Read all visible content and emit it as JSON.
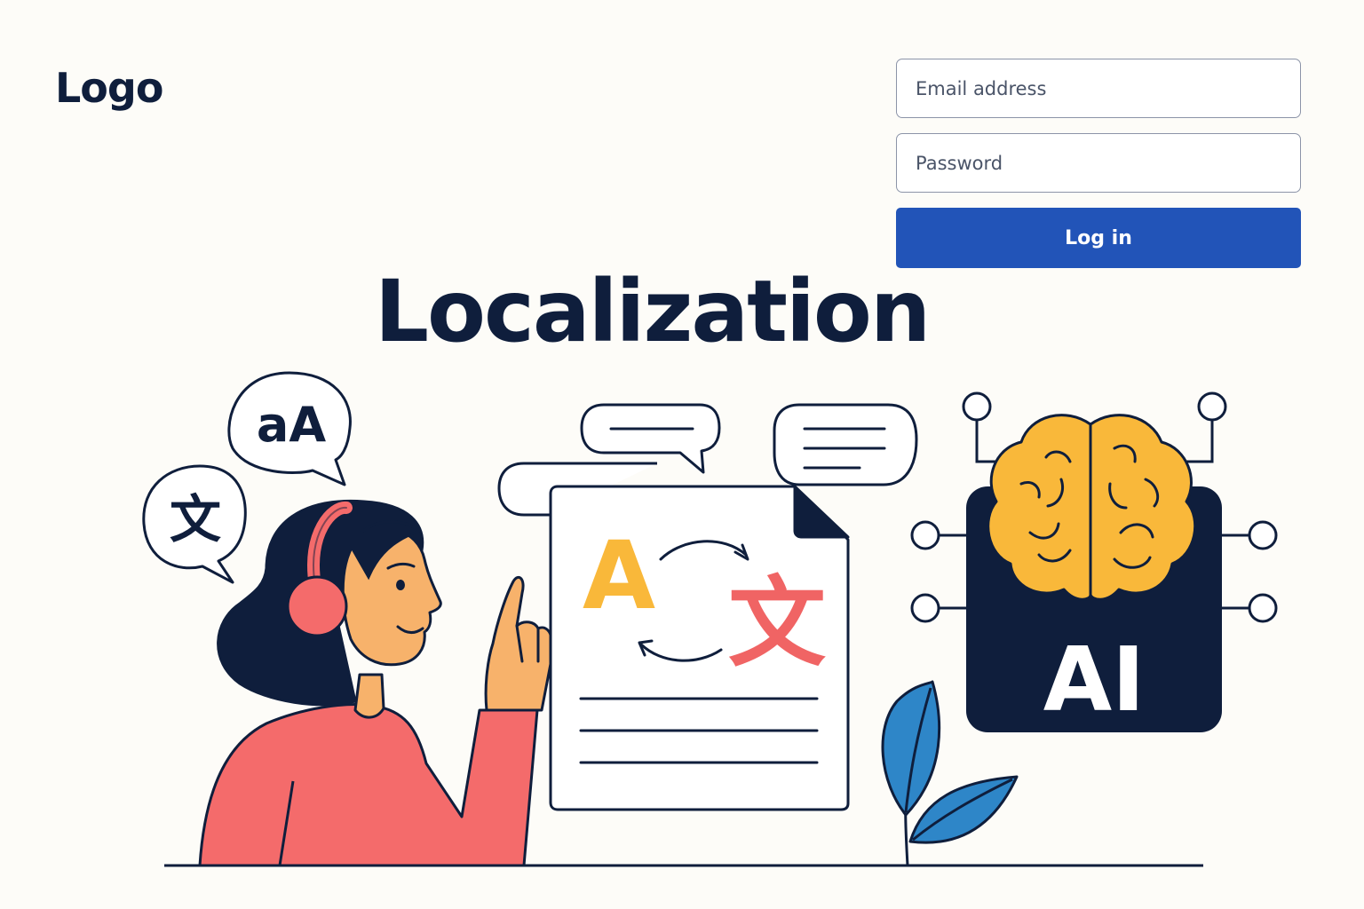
{
  "header": {
    "logo": "Logo"
  },
  "login": {
    "email_placeholder": "Email address",
    "password_placeholder": "Password",
    "submit_label": "Log in"
  },
  "hero": {
    "title": "Localization",
    "bubble_aA": "aA",
    "bubble_zh": "文",
    "doc_letter_latin": "A",
    "doc_letter_cjk": "文",
    "ai_label": "AI"
  },
  "icons": [
    "translate-bubble-icon",
    "case-bubble-icon",
    "document-translate-icon",
    "chat-bubble-icon",
    "brain-icon",
    "circuit-node-icon",
    "leaf-icon"
  ],
  "colors": {
    "background": "#fdfcf8",
    "ink": "#0f1e3c",
    "button": "#2254b8",
    "coral": "#f46b6b",
    "skin": "#f7b26b",
    "yellow": "#f9b83a",
    "blue_leaf": "#2e86c8",
    "red_glyph": "#f06464"
  }
}
